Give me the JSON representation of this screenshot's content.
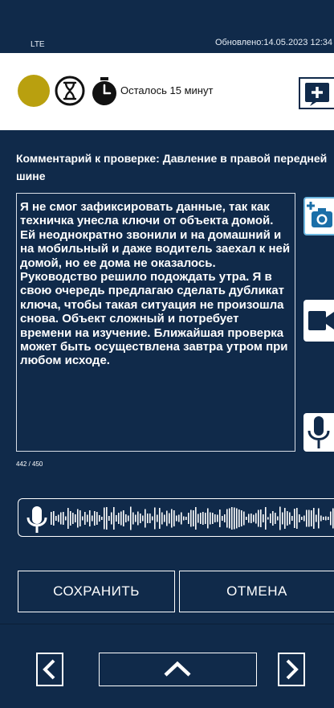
{
  "status_bar": {
    "network": "LTE",
    "updated": "Обновлено:14.05.2023 12:34"
  },
  "info_bar": {
    "status_color": "#b9a00f",
    "remaining": "Осталось 15 минут",
    "icons": [
      "status-dot",
      "hourglass-icon",
      "stopwatch-icon",
      "add-note-icon"
    ]
  },
  "comment": {
    "title": "Комментарий к проверке: Давление в правой передней шине",
    "text": "Я не смог зафиксировать данные, так как техничка унесла ключи от объекта домой. Ей неоднократно звонили и на домашний и на мобильный и даже водитель заехал к ней домой, но ее дома не оказалось. Руководство решило подождать утра. Я в свою очередь предлагаю сделать дубликат ключа, чтобы такая ситуация не произошла снова. Объект сложный и потребует времени на изучение. Ближайшая проверка может быть осуществлена завтра утром при любом исходе.",
    "counter": "442 / 450"
  },
  "side_actions": [
    "add-photo-icon",
    "video-icon",
    "microphone-icon"
  ],
  "actions": {
    "save_label": "СОХРАНИТЬ",
    "cancel_label": "ОТМЕНА"
  },
  "navigation": [
    "chevron-left-icon",
    "chevron-up-icon",
    "chevron-right-icon"
  ],
  "colors": {
    "background": "#102a4a",
    "panel": "#ffffff",
    "accent_border": "#6db7e0"
  }
}
